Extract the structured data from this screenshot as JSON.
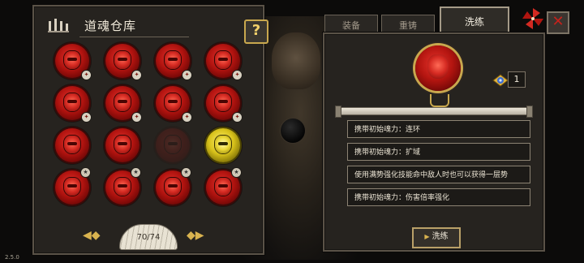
{
  "version": "2.5.0",
  "warehouse": {
    "title": "道魂仓库",
    "help_label": "?",
    "capacity_text": "70/74",
    "souls": [
      {
        "type": "red",
        "badge": "red"
      },
      {
        "type": "red",
        "badge": "red"
      },
      {
        "type": "red",
        "badge": "red"
      },
      {
        "type": "red",
        "badge": "red"
      },
      {
        "type": "red",
        "badge": "red"
      },
      {
        "type": "red",
        "badge": "red"
      },
      {
        "type": "red",
        "badge": "red"
      },
      {
        "type": "red",
        "badge": "red"
      },
      {
        "type": "red",
        "badge": "none"
      },
      {
        "type": "red",
        "badge": "none"
      },
      {
        "type": "empty",
        "badge": "none"
      },
      {
        "type": "gold",
        "badge": "none"
      },
      {
        "type": "red",
        "badge": "star"
      },
      {
        "type": "red",
        "badge": "star"
      },
      {
        "type": "red",
        "badge": "star"
      },
      {
        "type": "red",
        "badge": "star"
      }
    ]
  },
  "tabs": [
    {
      "label": "装备",
      "active": false
    },
    {
      "label": "重铸",
      "active": false
    },
    {
      "label": "洗练",
      "active": true
    }
  ],
  "detail": {
    "item_count": "1",
    "attributes": [
      "携带初始魂力：连环",
      "携带初始魂力：扩域",
      "使用满势强化技能命中敌人时也可以获得一层势",
      "携带初始魂力：伤害倍率强化"
    ],
    "refine_button": "洗练"
  },
  "icons": {
    "help": "question-icon",
    "close": "close-icon",
    "pinwheel": "pinwheel-icon",
    "item": "refine-material-icon",
    "header": "warehouse-icon"
  },
  "colors": {
    "accent_gold": "#c9a84e",
    "soul_red": "#b0130f",
    "soul_gold": "#d7c11a",
    "panel_bg": "#26231f"
  }
}
